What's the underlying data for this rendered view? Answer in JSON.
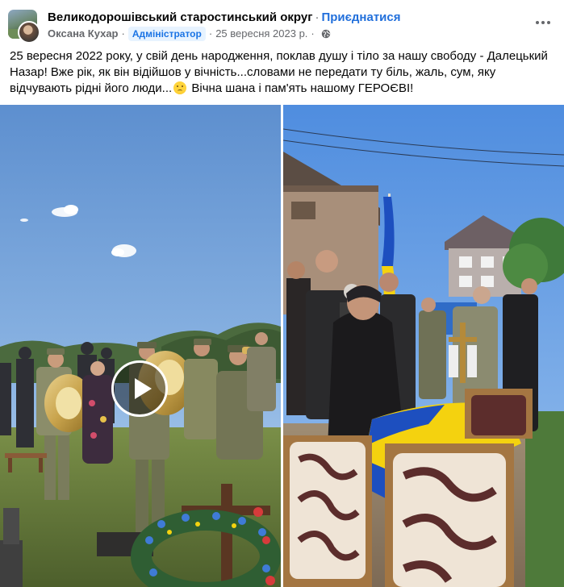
{
  "post": {
    "group_name": "Великодорошівський старостинський округ",
    "separator": "·",
    "join_label": "Приєднатися",
    "author": "Оксана Кухар",
    "role_badge": "Адміністратор",
    "date": "25 вересня 2023 р.",
    "privacy_icon": "globe-icon",
    "more_icon": "more-horizontal-icon",
    "text_part1": "25 вересня 2022 року, у свій день народження, поклав душу і тіло за нашу свободу - Далецький Назар! Вже рік, як він відійшов у вічність...словами не передати ту біль, жаль, сум, яку відчувають рідні його люди...",
    "text_emoji": "sad-face-emoji",
    "text_part2": " Вічна шана і пам'ять нашому ГЕРОЄВІ!"
  },
  "media": {
    "left": {
      "type": "video",
      "play_icon": "play-icon",
      "description_icon": "funeral-ceremony-with-military-band"
    },
    "right": {
      "type": "photo",
      "description_icon": "mourners-at-flag-draped-coffin"
    }
  },
  "colors": {
    "link": "#216fdb",
    "badge_bg": "#e7f3ff",
    "badge_text": "#1b74e4",
    "secondary_text": "#65676b",
    "flag_blue": "#1d4fbf",
    "flag_yellow": "#f4d20f"
  }
}
